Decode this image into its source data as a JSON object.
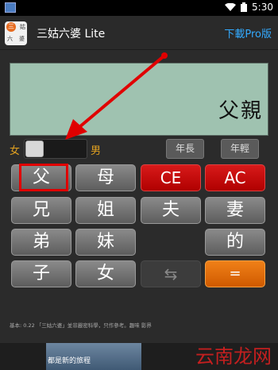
{
  "status_bar": {
    "time": "5:30"
  },
  "app_bar": {
    "logo_chars": [
      "三",
      "姑",
      "六",
      "婆"
    ],
    "title": "三姑六婆 Lite",
    "upgrade_link": "下載Pro版"
  },
  "display": {
    "result": "父親"
  },
  "gender": {
    "female": "女",
    "male": "男"
  },
  "age_buttons": {
    "older": "年長",
    "younger": "年輕"
  },
  "keys": {
    "father": "父",
    "mother": "母",
    "ce": "CE",
    "ac": "AC",
    "elder_brother": "兄",
    "elder_sister": "姐",
    "husband": "夫",
    "wife": "妻",
    "younger_brother": "弟",
    "younger_sister": "妹",
    "possessive": "的",
    "son": "子",
    "daughter": "女",
    "swap": "⇆",
    "equals": "="
  },
  "footer": {
    "note": "基本: 0.22  「三姑六婆」並非嚴密科學，只作參考。趣味 影界"
  },
  "ad": {
    "text": "都是新的旅程"
  },
  "watermark": {
    "text": "云南龙网"
  }
}
